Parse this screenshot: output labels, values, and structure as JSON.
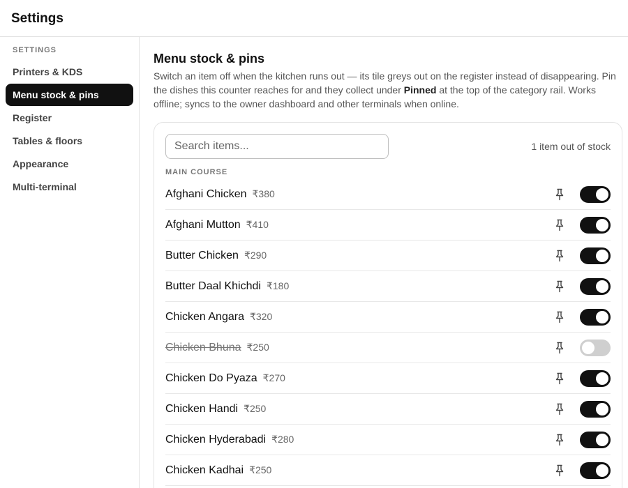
{
  "app": {
    "title": "Settings"
  },
  "sidebar": {
    "heading": "SETTINGS",
    "items": [
      {
        "label": "Printers & KDS",
        "active": false
      },
      {
        "label": "Menu stock & pins",
        "active": true
      },
      {
        "label": "Register",
        "active": false
      },
      {
        "label": "Tables & floors",
        "active": false
      },
      {
        "label": "Appearance",
        "active": false
      },
      {
        "label": "Multi-terminal",
        "active": false
      }
    ]
  },
  "main": {
    "title": "Menu stock & pins",
    "description_before": "Switch an item off when the kitchen runs out — its tile greys out on the register instead of disappearing. Pin the dishes this counter reaches for and they collect under ",
    "description_bold": "Pinned",
    "description_after": " at the top of the category rail. Works offline; syncs to the owner dashboard and other terminals when online.",
    "search": {
      "placeholder": "Search items...",
      "value": ""
    },
    "stock_count": "1 item out of stock",
    "section_label": "MAIN COURSE",
    "items": [
      {
        "name": "Afghani Chicken",
        "price": "₹380",
        "in_stock": true
      },
      {
        "name": "Afghani Mutton",
        "price": "₹410",
        "in_stock": true
      },
      {
        "name": "Butter Chicken",
        "price": "₹290",
        "in_stock": true
      },
      {
        "name": "Butter Daal Khichdi",
        "price": "₹180",
        "in_stock": true
      },
      {
        "name": "Chicken Angara",
        "price": "₹320",
        "in_stock": true
      },
      {
        "name": "Chicken Bhuna",
        "price": "₹250",
        "in_stock": false
      },
      {
        "name": "Chicken Do Pyaza",
        "price": "₹270",
        "in_stock": true
      },
      {
        "name": "Chicken Handi",
        "price": "₹250",
        "in_stock": true
      },
      {
        "name": "Chicken Hyderabadi",
        "price": "₹280",
        "in_stock": true
      },
      {
        "name": "Chicken Kadhai",
        "price": "₹250",
        "in_stock": true
      }
    ]
  },
  "icons": {
    "pin": "pin-icon"
  },
  "colors": {
    "accent": "#111111",
    "toggle_off": "#cfcfcf",
    "active_nav_text": "#ffffff"
  }
}
